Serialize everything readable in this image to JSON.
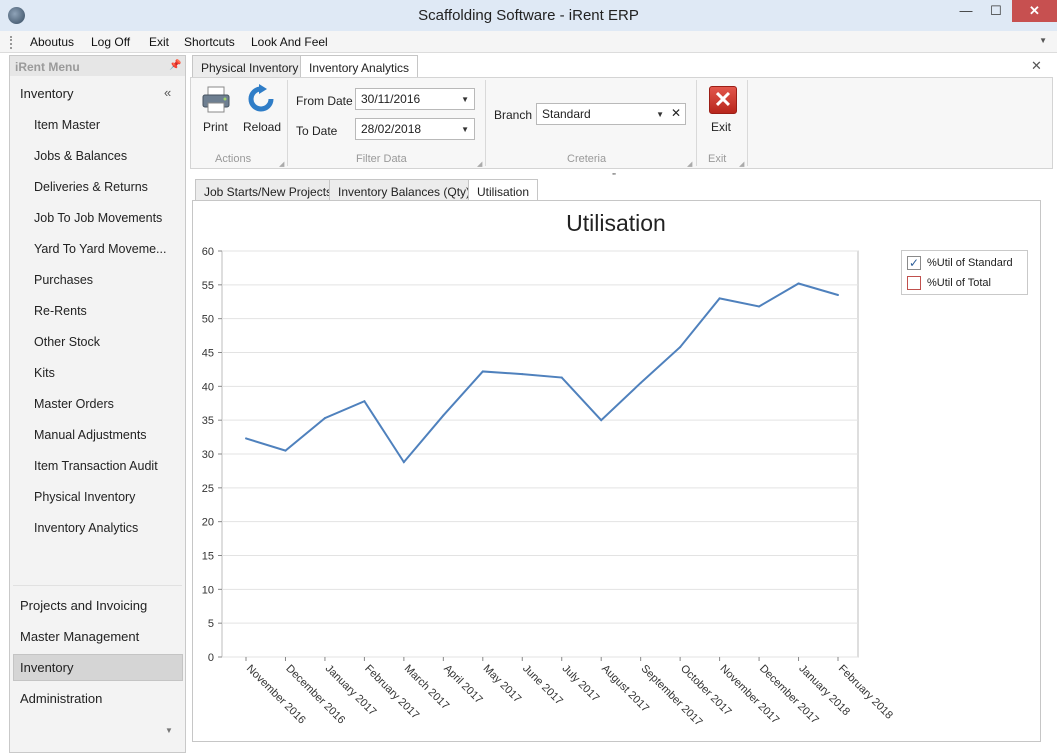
{
  "window": {
    "title": "Scaffolding Software - iRent ERP",
    "minimize_glyph": "—",
    "maximize_glyph": "☐",
    "close_glyph": "✕"
  },
  "menubar": {
    "items": [
      "Aboutus",
      "Log Off",
      "Exit",
      "Shortcuts",
      "Look And Feel"
    ],
    "overflow_glyph": "▼"
  },
  "sidebar": {
    "header": "iRent Menu",
    "pin_glyph": "📌",
    "active_group": "Inventory",
    "collapse_glyph": "«",
    "items": [
      "Item Master",
      "Jobs & Balances",
      "Deliveries & Returns",
      "Job To Job Movements",
      "Yard To Yard Moveme...",
      "Purchases",
      "Re-Rents",
      "Other Stock",
      "Kits",
      "Master Orders",
      "Manual Adjustments",
      "Item Transaction Audit",
      "Physical Inventory",
      "Inventory Analytics"
    ],
    "groups": [
      "Projects and Invoicing",
      "Master Management",
      "Inventory",
      "Administration"
    ],
    "selected_group_index": 2,
    "footer_glyph": "▼"
  },
  "doc_tabs": {
    "tabs": [
      "Physical Inventory",
      "Inventory Analytics"
    ],
    "active": 1,
    "close_glyph": "✕"
  },
  "ribbon": {
    "actions": {
      "label": "Actions",
      "print": "Print",
      "reload": "Reload"
    },
    "filter": {
      "label": "Filter Data",
      "from_label": "From Date",
      "from_value": "30/11/2016",
      "to_label": "To Date",
      "to_value": "28/02/2018"
    },
    "criteria": {
      "label": "Creteria",
      "branch_label": "Branch",
      "branch_value": "Standard"
    },
    "exit": {
      "label": "Exit",
      "button": "Exit"
    },
    "exit_glyph": "✕",
    "dropdown_glyph": "▼",
    "clear_glyph": "✕"
  },
  "sub_tabs": {
    "tabs": [
      "Job Starts/New Projects",
      "Inventory Balances (Qty)",
      "Utilisation"
    ],
    "active": 2
  },
  "chart_data": {
    "type": "line",
    "title": "Utilisation",
    "categories": [
      "November 2016",
      "December 2016",
      "January 2017",
      "February 2017",
      "March 2017",
      "April 2017",
      "May 2017",
      "June 2017",
      "July 2017",
      "August 2017",
      "September 2017",
      "October 2017",
      "November 2017",
      "December 2017",
      "January 2018",
      "February 2018"
    ],
    "series": [
      {
        "name": "%Util of Standard",
        "visible": true,
        "color": "#4f81bd",
        "values": [
          32.3,
          30.5,
          35.3,
          37.8,
          28.8,
          35.7,
          42.2,
          41.8,
          41.3,
          35.0,
          40.5,
          45.8,
          53.0,
          51.8,
          55.2,
          53.5
        ]
      },
      {
        "name": "%Util of Total",
        "visible": false,
        "color": "#c0504d",
        "values": []
      }
    ],
    "ylim": [
      0,
      60
    ],
    "yticks": [
      0,
      5,
      10,
      15,
      20,
      25,
      30,
      35,
      40,
      45,
      50,
      55,
      60
    ],
    "grid": true,
    "legend_position": "top-right",
    "checked_glyph": "✓"
  }
}
